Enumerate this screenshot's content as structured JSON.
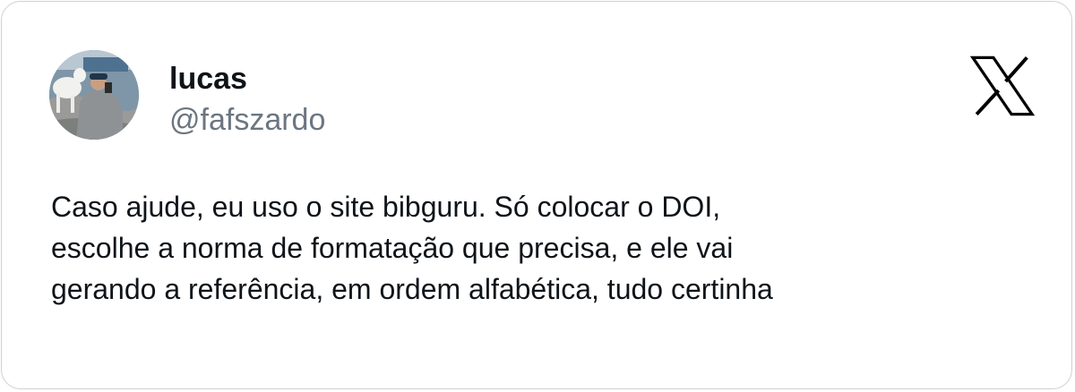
{
  "author": {
    "display_name": "lucas",
    "handle": "@fafszardo"
  },
  "brand": {
    "icon": "x-logo-icon",
    "color": "#000000"
  },
  "tweet": {
    "lines": [
      "Caso ajude, eu uso o site bibguru. Só colocar o DOI,",
      "escolhe a norma de formatação que precisa, e ele vai",
      "gerando a referência, em ordem alfabética, tudo certinha"
    ]
  },
  "colors": {
    "text_primary": "#0f1419",
    "text_secondary": "#6b7681",
    "border": "#d0d0d0"
  }
}
